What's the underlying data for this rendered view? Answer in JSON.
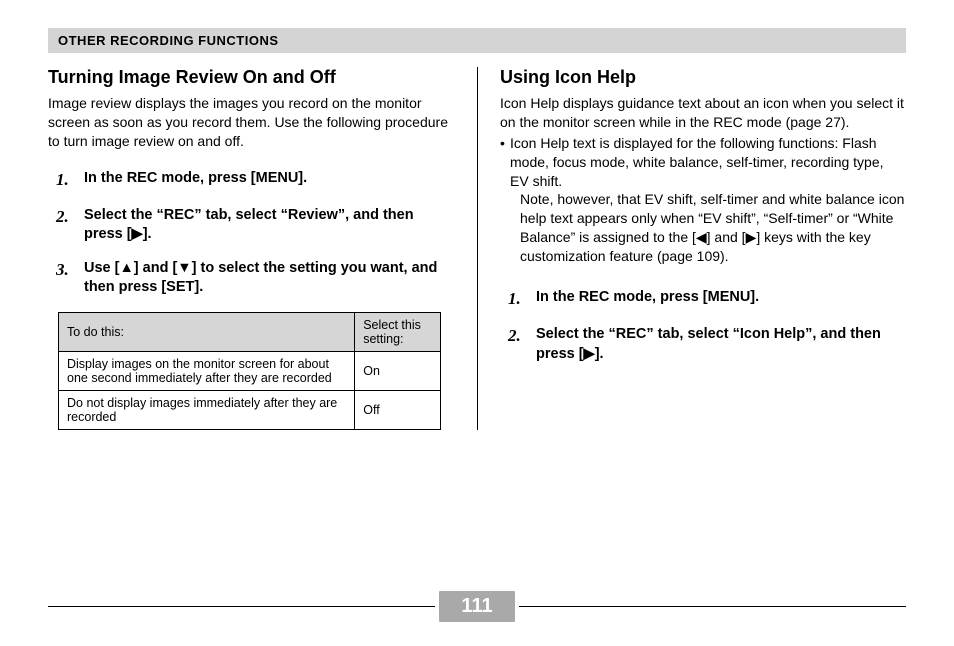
{
  "chapter": "OTHER RECORDING FUNCTIONS",
  "pageNumber": "111",
  "left": {
    "heading": "Turning Image Review On and Off",
    "intro": "Image review displays the images you record on the monitor screen as soon as you record them. Use the following procedure to turn image review on and off.",
    "steps": [
      "In the REC mode, press [MENU].",
      "Select the “REC” tab, select “Review”, and then press [▶].",
      "Use [▲] and [▼] to select the setting you want, and then press [SET]."
    ],
    "table": {
      "headers": [
        "To do this:",
        "Select this setting:"
      ],
      "rows": [
        [
          "Display images on the monitor screen for about one second immediately after they are recorded",
          "On"
        ],
        [
          "Do not display images immediately after they are recorded",
          "Off"
        ]
      ]
    }
  },
  "right": {
    "heading": "Using Icon Help",
    "intro": "Icon Help displays guidance text about an icon when you select it on the monitor screen while in the REC mode (page 27).",
    "bullet": "Icon Help text is displayed for the following functions: Flash mode, focus mode, white balance, self-timer, recording type, EV shift.",
    "note": "Note, however, that EV shift, self-timer and white balance icon help text appears only when “EV shift”, “Self-timer” or “White Balance” is assigned to the [◀] and [▶] keys with the key customization feature (page 109).",
    "steps": [
      "In the REC mode, press [MENU].",
      "Select the “REC” tab, select “Icon Help”, and then press [▶]."
    ]
  }
}
